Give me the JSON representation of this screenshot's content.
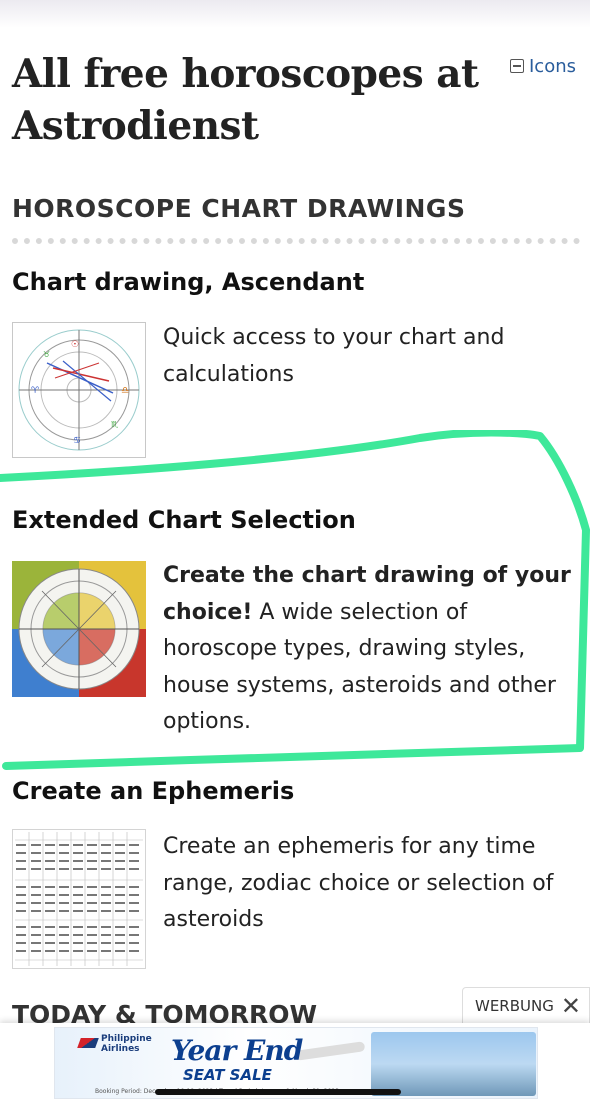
{
  "page": {
    "title": "All free horoscopes at Astrodienst",
    "icons_toggle_label": "Icons"
  },
  "section": {
    "heading": "HOROSCOPE CHART DRAWINGS",
    "items": [
      {
        "title": "Chart drawing, Ascendant",
        "description": "Quick access to your chart and calculations"
      },
      {
        "title": "Extended Chart Selection",
        "description_bold": "Create the chart drawing of your choice!",
        "description": " A wide selection of horoscope types, drawing styles, house systems, asteroids and other options."
      },
      {
        "title": "Create an Ephemeris",
        "description": "Create an ephemeris for any time range, zodiac choice or selection of asteroids"
      }
    ]
  },
  "next_section": {
    "heading": "TODAY & TOMORROW"
  },
  "ad": {
    "label": "WERBUNG",
    "brand": "Philippine Airlines",
    "headline": "Year End",
    "subheadline": "SEAT SALE",
    "fine_print": "Booking Period: December 10-18, 2022 | Travel Period: January 1-March 31, 2023"
  },
  "colors": {
    "highlight": "#3ee89a",
    "link": "#2a5d9c"
  },
  "icons": {
    "toggle": "minus-box-icon",
    "close": "close-icon"
  }
}
